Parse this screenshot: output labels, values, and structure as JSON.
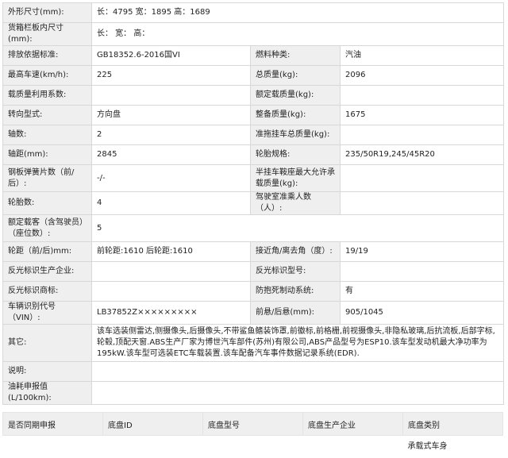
{
  "rows": [
    [
      "外形尺寸(mm):",
      "长：4795 宽：1895 高：1689"
    ],
    [
      "货箱栏板内尺寸(mm):",
      "长： 宽： 高："
    ],
    [
      "排放依据标准:",
      "GB18352.6-2016国VI",
      "燃料种类:",
      "汽油"
    ],
    [
      "最高车速(km/h):",
      "225",
      "总质量(kg):",
      "2096"
    ],
    [
      "载质量利用系数:",
      "",
      "额定载质量(kg):",
      ""
    ],
    [
      "转向型式:",
      "方向盘",
      "整备质量(kg):",
      "1675"
    ],
    [
      "轴数:",
      "2",
      "准拖挂车总质量(kg):",
      ""
    ],
    [
      "轴距(mm):",
      "2845",
      "轮胎规格:",
      "235/50R19,245/45R20"
    ],
    [
      "钢板弹簧片数（前/后）:",
      "-/-",
      "半挂车鞍座最大允许承载质量(kg):",
      ""
    ],
    [
      "轮胎数:",
      "4",
      "驾驶室准乘人数（人）:",
      ""
    ],
    [
      "额定载客（含驾驶员）（座位数）:",
      "5"
    ],
    [
      "轮距（前/后)mm:",
      "前轮距:1610 后轮距:1610",
      "接近角/离去角（度）:",
      "19/19"
    ],
    [
      "反光标识生产企业:",
      "",
      "反光标识型号:",
      ""
    ],
    [
      "反光标识商标:",
      "",
      "防抱死制动系统:",
      "有"
    ],
    [
      "车辆识别代号（VIN）:",
      "LB37852Z×××××××××",
      "前悬/后悬(mm):",
      "905/1045"
    ],
    [
      "其它:",
      "该车选装侧雷达,侧摄像头,后摄像头,不带鲨鱼鳍装饰罩,前徽标,前格栅,前视摄像头,非隐私玻璃,后抗流板,后部字标,轮毂,顶配天窗.ABS生产厂家为博世汽车部件(苏州)有限公司,ABS产品型号为ESP10.该车型发动机最大净功率为195kW.该车型可选装ETC车载装置.该车配备汽车事件数据记录系统(EDR)."
    ],
    [
      "说明:",
      ""
    ],
    [
      "油耗申报值(L/100km):",
      ""
    ]
  ],
  "chassis": {
    "headers": [
      "是否同期申报",
      "底盘ID",
      "底盘型号",
      "底盘生产企业",
      "底盘类别"
    ],
    "row": [
      "",
      "",
      "",
      "",
      "承载式车身"
    ]
  }
}
